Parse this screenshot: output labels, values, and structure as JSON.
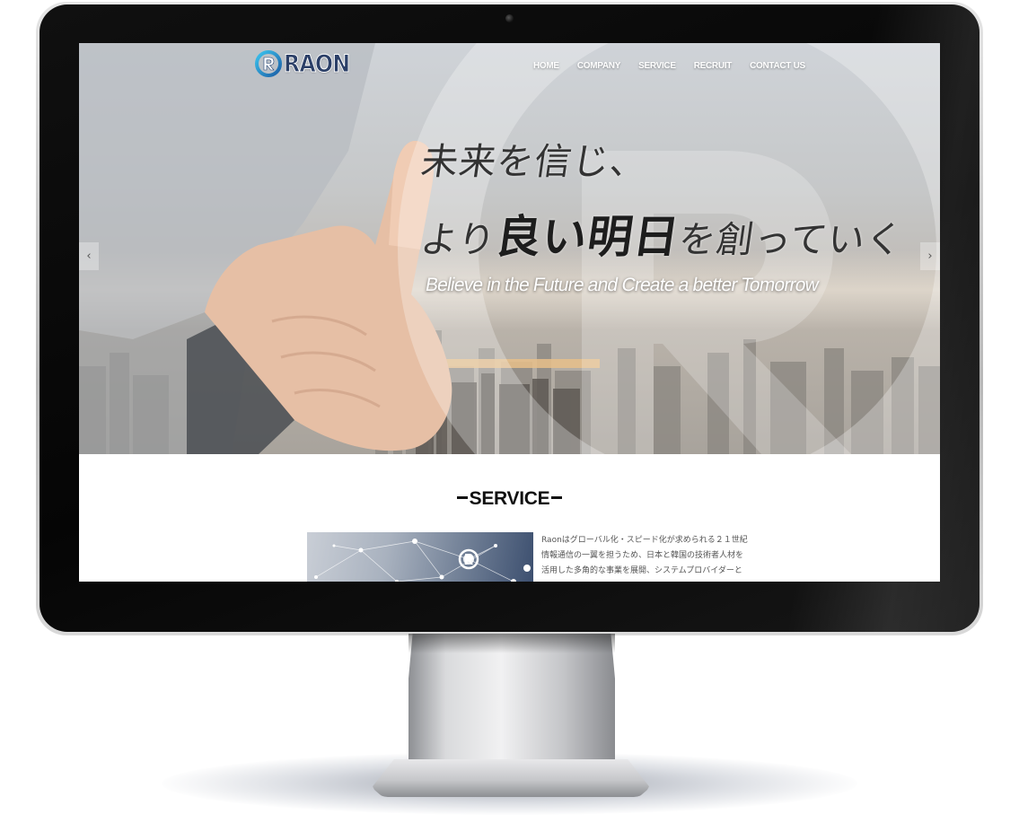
{
  "site": {
    "logo_text": "RAON",
    "nav": [
      {
        "label": "HOME"
      },
      {
        "label": "COMPANY"
      },
      {
        "label": "SERVICE"
      },
      {
        "label": "RECRUIT"
      },
      {
        "label": "CONTACT US"
      }
    ]
  },
  "hero": {
    "headline_line1": "未来を信じ、",
    "headline_line2_a": "より",
    "headline_line2_strong": "良い明日",
    "headline_line2_b": "を創っていく",
    "tagline": "Believe in the Future and Create a better Tomorrow",
    "prev_arrow": "‹",
    "next_arrow": "›",
    "icons": {
      "prev": "chevron-left-icon",
      "next": "chevron-right-icon"
    }
  },
  "service": {
    "title": "SERVICE",
    "description_lines": [
      "Raonはグローバル化・スピード化が求められる２１世紀",
      "情報通信の一翼を担うため、日本と韓国の技術者人材を",
      "活用した多角的な事業を展開、システムプロバイダーと"
    ]
  },
  "colors": {
    "logo_blue": "#2b3f67",
    "logo_cyan": "#2aa7d6",
    "nav_text": "#ffffff",
    "headline": "#333333",
    "bezel": "#0a0a0a"
  }
}
